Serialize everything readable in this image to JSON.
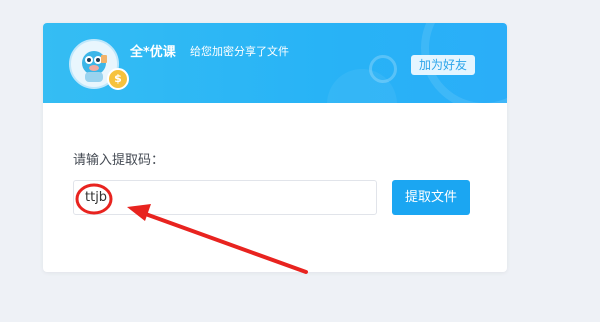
{
  "header": {
    "username": "全*优课",
    "share_text": "给您加密分享了文件",
    "add_friend_label": "加为好友",
    "coin_symbol": "$"
  },
  "form": {
    "prompt": "请输入提取码：",
    "code_value": "ttjb",
    "submit_label": "提取文件"
  },
  "colors": {
    "header_gradient_start": "#35bdf3",
    "header_gradient_end": "#2aaef8",
    "button": "#1ba6f2",
    "annotation": "#e8231f",
    "page_background": "#eef1f6"
  },
  "icons": {
    "avatar": "mascot-avatar-icon",
    "coin": "coin-icon"
  }
}
